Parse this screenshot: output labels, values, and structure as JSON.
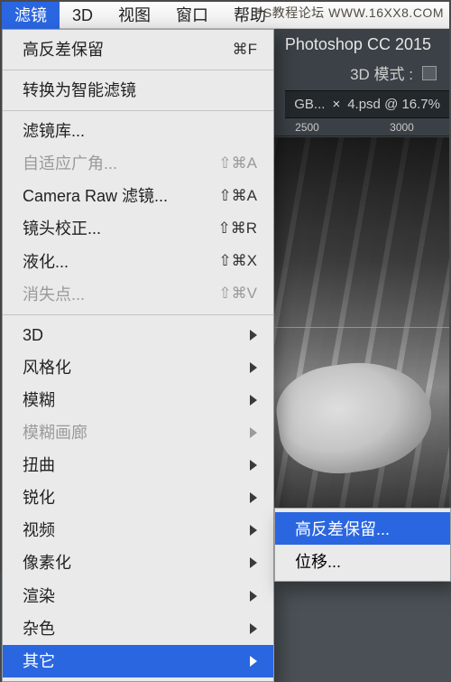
{
  "watermark": "PS教程论坛  WWW.16XX8.COM",
  "menubar": {
    "items": [
      "滤镜",
      "3D",
      "视图",
      "窗口",
      "帮助"
    ],
    "selected_index": 0
  },
  "ps": {
    "title": "Photoshop CC 2015",
    "mode_label": "3D 模式 :",
    "tab_prefix": "GB...",
    "tab_label": "4.psd @ 16.7%",
    "ruler_ticks": [
      "2500",
      "3000"
    ]
  },
  "dropdown": {
    "groups": [
      [
        {
          "label": "高反差保留",
          "shortcut": "⌘F",
          "sub": false,
          "disabled": false
        }
      ],
      [
        {
          "label": "转换为智能滤镜",
          "shortcut": "",
          "sub": false,
          "disabled": false
        }
      ],
      [
        {
          "label": "滤镜库...",
          "shortcut": "",
          "sub": false,
          "disabled": false
        },
        {
          "label": "自适应广角...",
          "shortcut": "⇧⌘A",
          "sub": false,
          "disabled": true
        },
        {
          "label": "Camera Raw 滤镜...",
          "shortcut": "⇧⌘A",
          "sub": false,
          "disabled": false
        },
        {
          "label": "镜头校正...",
          "shortcut": "⇧⌘R",
          "sub": false,
          "disabled": false
        },
        {
          "label": "液化...",
          "shortcut": "⇧⌘X",
          "sub": false,
          "disabled": false
        },
        {
          "label": "消失点...",
          "shortcut": "⇧⌘V",
          "sub": false,
          "disabled": true
        }
      ],
      [
        {
          "label": "3D",
          "shortcut": "",
          "sub": true,
          "disabled": false
        },
        {
          "label": "风格化",
          "shortcut": "",
          "sub": true,
          "disabled": false
        },
        {
          "label": "模糊",
          "shortcut": "",
          "sub": true,
          "disabled": false
        },
        {
          "label": "模糊画廊",
          "shortcut": "",
          "sub": true,
          "disabled": true
        },
        {
          "label": "扭曲",
          "shortcut": "",
          "sub": true,
          "disabled": false
        },
        {
          "label": "锐化",
          "shortcut": "",
          "sub": true,
          "disabled": false
        },
        {
          "label": "视频",
          "shortcut": "",
          "sub": true,
          "disabled": false
        },
        {
          "label": "像素化",
          "shortcut": "",
          "sub": true,
          "disabled": false
        },
        {
          "label": "渲染",
          "shortcut": "",
          "sub": true,
          "disabled": false
        },
        {
          "label": "杂色",
          "shortcut": "",
          "sub": true,
          "disabled": false
        },
        {
          "label": "其它",
          "shortcut": "",
          "sub": true,
          "disabled": false,
          "selected": true
        }
      ]
    ]
  },
  "submenu": {
    "items": [
      {
        "label": "高反差保留...",
        "selected": true
      },
      {
        "label": "位移...",
        "selected": false
      }
    ]
  }
}
